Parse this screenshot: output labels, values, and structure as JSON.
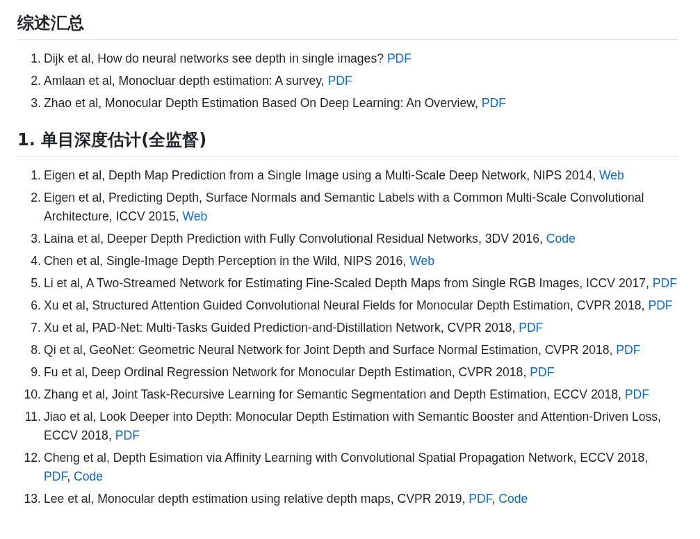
{
  "sections": [
    {
      "title": "综述汇总",
      "items": [
        {
          "number": "1.",
          "parts": [
            {
              "kind": "text",
              "text": "Dijk et al, How do neural networks see depth in single images? "
            },
            {
              "kind": "link",
              "text": "PDF"
            }
          ]
        },
        {
          "number": "2.",
          "parts": [
            {
              "kind": "text",
              "text": "Amlaan et al, Monocluar depth estimation: A survey, "
            },
            {
              "kind": "link",
              "text": "PDF"
            }
          ]
        },
        {
          "number": "3.",
          "parts": [
            {
              "kind": "text",
              "text": "Zhao et al, Monocular Depth Estimation Based On Deep Learning: An Overview, "
            },
            {
              "kind": "link",
              "text": "PDF"
            }
          ]
        }
      ]
    },
    {
      "title": "1. 单目深度估计(全监督)",
      "items": [
        {
          "number": "1.",
          "parts": [
            {
              "kind": "text",
              "text": "Eigen et al, Depth Map Prediction from a Single Image using a Multi-Scale Deep Network, NIPS 2014, "
            },
            {
              "kind": "link",
              "text": "Web"
            }
          ]
        },
        {
          "number": "2.",
          "parts": [
            {
              "kind": "text",
              "text": "Eigen et al, Predicting Depth, Surface Normals and Semantic Labels with a Common Multi-Scale Convolutional Architecture, ICCV 2015, "
            },
            {
              "kind": "link",
              "text": "Web"
            }
          ]
        },
        {
          "number": "3.",
          "parts": [
            {
              "kind": "text",
              "text": "Laina et al, Deeper Depth Prediction with Fully Convolutional Residual Networks, 3DV 2016, "
            },
            {
              "kind": "link",
              "text": "Code"
            }
          ]
        },
        {
          "number": "4.",
          "parts": [
            {
              "kind": "text",
              "text": "Chen et al, Single-Image Depth Perception in the Wild, NIPS 2016, "
            },
            {
              "kind": "link",
              "text": "Web"
            }
          ]
        },
        {
          "number": "5.",
          "parts": [
            {
              "kind": "text",
              "text": "Li et al, A Two-Streamed Network for Estimating Fine-Scaled Depth Maps from Single RGB Images, ICCV 2017, "
            },
            {
              "kind": "link",
              "text": "PDF"
            }
          ]
        },
        {
          "number": "6.",
          "parts": [
            {
              "kind": "text",
              "text": "Xu et al, Structured Attention Guided Convolutional Neural Fields for Monocular Depth Estimation, CVPR 2018, "
            },
            {
              "kind": "link",
              "text": "PDF"
            }
          ]
        },
        {
          "number": "7.",
          "parts": [
            {
              "kind": "text",
              "text": "Xu et al, PAD-Net: Multi-Tasks Guided Prediction-and-Distillation Network, CVPR 2018, "
            },
            {
              "kind": "link",
              "text": "PDF"
            }
          ]
        },
        {
          "number": "8.",
          "parts": [
            {
              "kind": "text",
              "text": "Qi et al, GeoNet: Geometric Neural Network for Joint Depth and Surface Normal Estimation, CVPR 2018, "
            },
            {
              "kind": "link",
              "text": "PDF"
            }
          ]
        },
        {
          "number": "9.",
          "parts": [
            {
              "kind": "text",
              "text": "Fu et al, Deep Ordinal Regression Network for Monocular Depth Estimation, CVPR 2018, "
            },
            {
              "kind": "link",
              "text": "PDF"
            }
          ]
        },
        {
          "number": "10.",
          "parts": [
            {
              "kind": "text",
              "text": "Zhang et al, Joint Task-Recursive Learning for Semantic Segmentation and Depth Estimation, ECCV 2018, "
            },
            {
              "kind": "link",
              "text": "PDF"
            }
          ]
        },
        {
          "number": "11.",
          "parts": [
            {
              "kind": "text",
              "text": "Jiao et al, Look Deeper into Depth: Monocular Depth Estimation with Semantic Booster and Attention-Driven Loss, ECCV 2018, "
            },
            {
              "kind": "link",
              "text": "PDF"
            }
          ]
        },
        {
          "number": "12.",
          "parts": [
            {
              "kind": "text",
              "text": "Cheng et al, Depth Esimation via Affinity Learning with Convolutional Spatial Propagation Network, ECCV 2018, "
            },
            {
              "kind": "link",
              "text": "PDF",
              "suffix": ", "
            },
            {
              "kind": "link",
              "text": "Code"
            }
          ]
        },
        {
          "number": "13.",
          "parts": [
            {
              "kind": "text",
              "text": "Lee et al, Monocular depth estimation using relative depth maps, CVPR 2019, "
            },
            {
              "kind": "link",
              "text": "PDF",
              "suffix": ", "
            },
            {
              "kind": "link",
              "text": "Code"
            }
          ]
        }
      ]
    }
  ]
}
